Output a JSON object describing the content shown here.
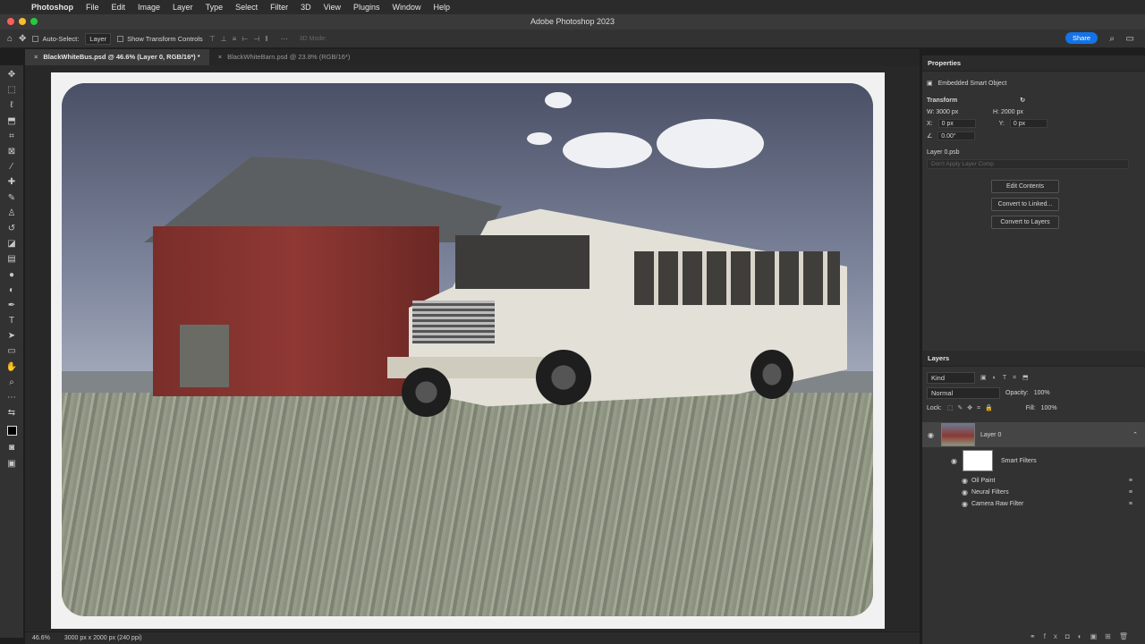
{
  "menu": {
    "app": "Photoshop",
    "items": [
      "File",
      "Edit",
      "Image",
      "Layer",
      "Type",
      "Select",
      "Filter",
      "3D",
      "View",
      "Plugins",
      "Window",
      "Help"
    ]
  },
  "window": {
    "title": "Adobe Photoshop 2023"
  },
  "options": {
    "auto_select_label": "Auto-Select:",
    "auto_select_value": "Layer",
    "transform_label": "Show Transform Controls",
    "mode_3d": "3D Mode:",
    "share": "Share"
  },
  "tabs": [
    {
      "label": "BlackWhiteBus.psd @ 46.6% (Layer 0, RGB/16*) *"
    },
    {
      "label": "BlackWhiteBarn.psd @ 23.8% (RGB/16*)"
    }
  ],
  "properties": {
    "title": "Properties",
    "type": "Embedded Smart Object",
    "transform_label": "Transform",
    "w": "W: 3000 px",
    "h": "H: 2000 px",
    "x_label": "X:",
    "x": "0 px",
    "y_label": "Y:",
    "y": "0 px",
    "angle": "0.00°",
    "source": "Layer 0.psb",
    "comp_placeholder": "Don't Apply Layer Comp",
    "buttons": [
      "Edit Contents",
      "Convert to Linked...",
      "Convert to Layers"
    ]
  },
  "layers": {
    "title": "Layers",
    "kind": "Kind",
    "blend": "Normal",
    "opacity_label": "Opacity:",
    "opacity": "100%",
    "lock_label": "Lock:",
    "fill_label": "Fill:",
    "fill": "100%",
    "items": [
      {
        "name": "Layer 0"
      },
      {
        "name": "Smart Filters"
      },
      {
        "name": "Oil Paint"
      },
      {
        "name": "Neural Filters"
      },
      {
        "name": "Camera Raw Filter"
      }
    ]
  },
  "status": {
    "zoom": "46.6%",
    "doc_info": "3000 px x 2000 px (240 ppi)"
  }
}
